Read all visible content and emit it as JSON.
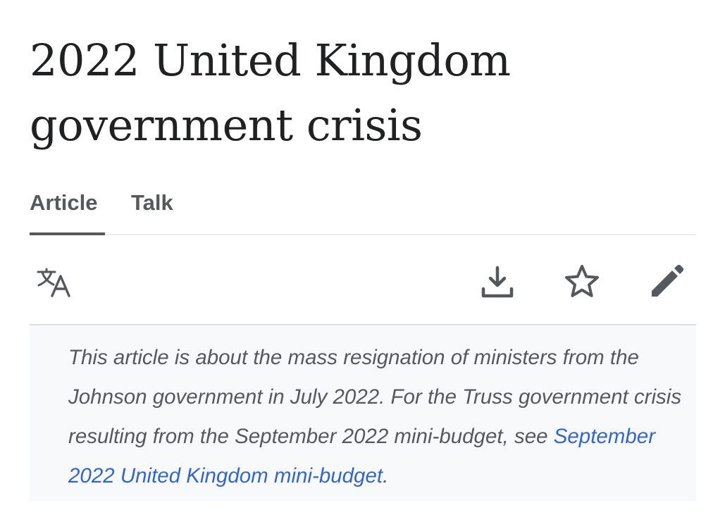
{
  "article": {
    "title": "2022 United Kingdom government crisis"
  },
  "tabs": [
    {
      "label": "Article",
      "selected": true
    },
    {
      "label": "Talk",
      "selected": false
    }
  ],
  "toolbar": {
    "icons": [
      "language-icon",
      "download-icon",
      "star-icon",
      "edit-pencil-icon"
    ]
  },
  "hatnote": {
    "text": "This article is about the mass resignation of ministers from the Johnson government in July 2022. For the Truss government crisis resulting from the September 2022 mini-budget, see ",
    "link_text": "September 2022 United Kingdom mini-budget",
    "trailing": "."
  },
  "colors": {
    "link": "#3366cc",
    "tab_active_underline": "#54595d",
    "hatnote_background": "#f8f9fa"
  }
}
